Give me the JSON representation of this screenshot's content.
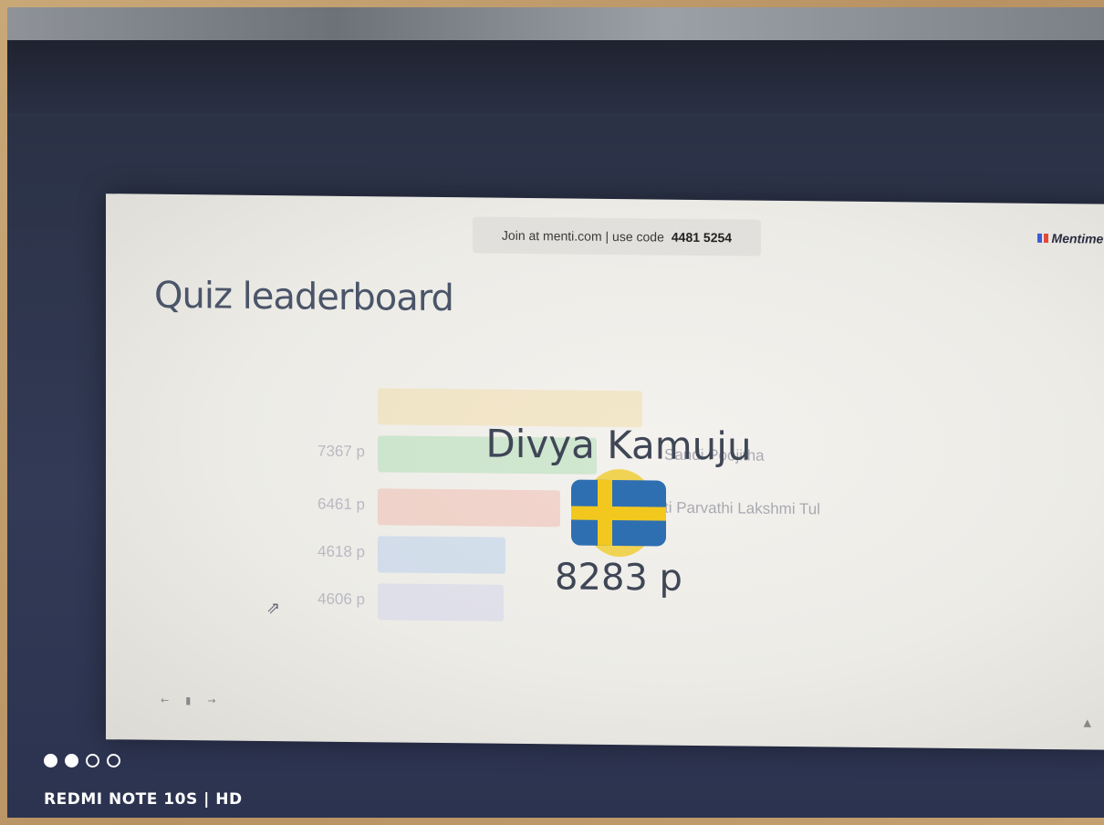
{
  "slide": {
    "join_text": "Join at menti.com | use code",
    "join_code": "4481 5254",
    "brand": "Mentimet",
    "title": "Quiz leaderboard"
  },
  "ghost_rows": [
    {
      "score": "7367 p",
      "name": "Sandi Poojitha"
    },
    {
      "score": "6461 p",
      "name": "ti Parvathi Lakshmi Tul"
    },
    {
      "score": "4618 p",
      "name": ""
    },
    {
      "score": "4606 p",
      "name": ""
    }
  ],
  "winner": {
    "name": "Divya Kamuju",
    "score": "8283 p",
    "flag_icon": "sweden-flag-icon"
  },
  "camera": {
    "watermark": "REDMI NOTE 10S | HD"
  },
  "colors": {
    "bar_yellow": "#f4d38a",
    "bar_green": "#8fd39a",
    "bar_red": "#f0a08f",
    "bar_blue": "#9fc0ee",
    "bar_lilac": "#c7c9ee"
  }
}
